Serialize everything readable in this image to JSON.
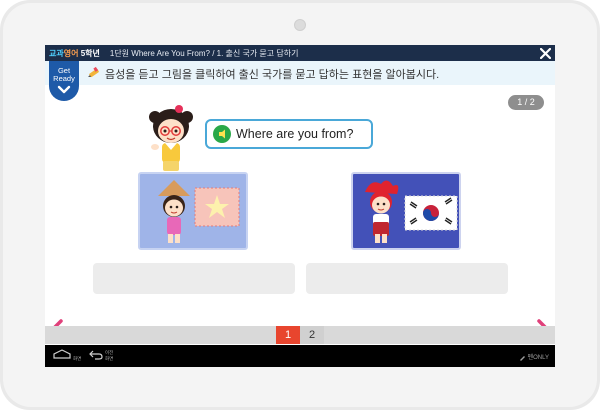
{
  "header": {
    "brand_parts": [
      "교과",
      "영어",
      " 5학년"
    ],
    "breadcrumb": "1단원 Where Are You From? / 1. 출신 국가 묻고 답하기"
  },
  "badge": {
    "line1": "Get",
    "line2": "Ready"
  },
  "instruction": "음성을 듣고 그림을 클릭하여 출신 국가를 묻고 답하는 표현을 알아봅시다.",
  "page_indicator": "1 / 2",
  "speech_bubble": {
    "text": "Where are you from?"
  },
  "pager": {
    "pages": [
      "1",
      "2"
    ],
    "current": "1"
  },
  "system_bar": {
    "home_label": "화면",
    "back_label_1": "이전",
    "back_label_2": "화면",
    "pen_label": "펜ONLY"
  },
  "colors": {
    "topbar": "#1c2e4a",
    "instruction_bg": "#eaf5fb",
    "badge": "#1e5aa8",
    "bubble_border": "#4aa8d8",
    "speaker": "#2aa848",
    "left_card": "#9fb4e8",
    "right_card": "#4351b8",
    "current_page": "#e8452e",
    "nav_arrow": "#e0407a"
  },
  "icons": {
    "close": "close-icon",
    "pencil": "pencil-icon",
    "chevron": "chevron-down-icon",
    "speaker": "speaker-icon",
    "home": "home-icon",
    "back": "back-icon",
    "prev": "chevron-left-icon",
    "next": "chevron-right-icon"
  }
}
